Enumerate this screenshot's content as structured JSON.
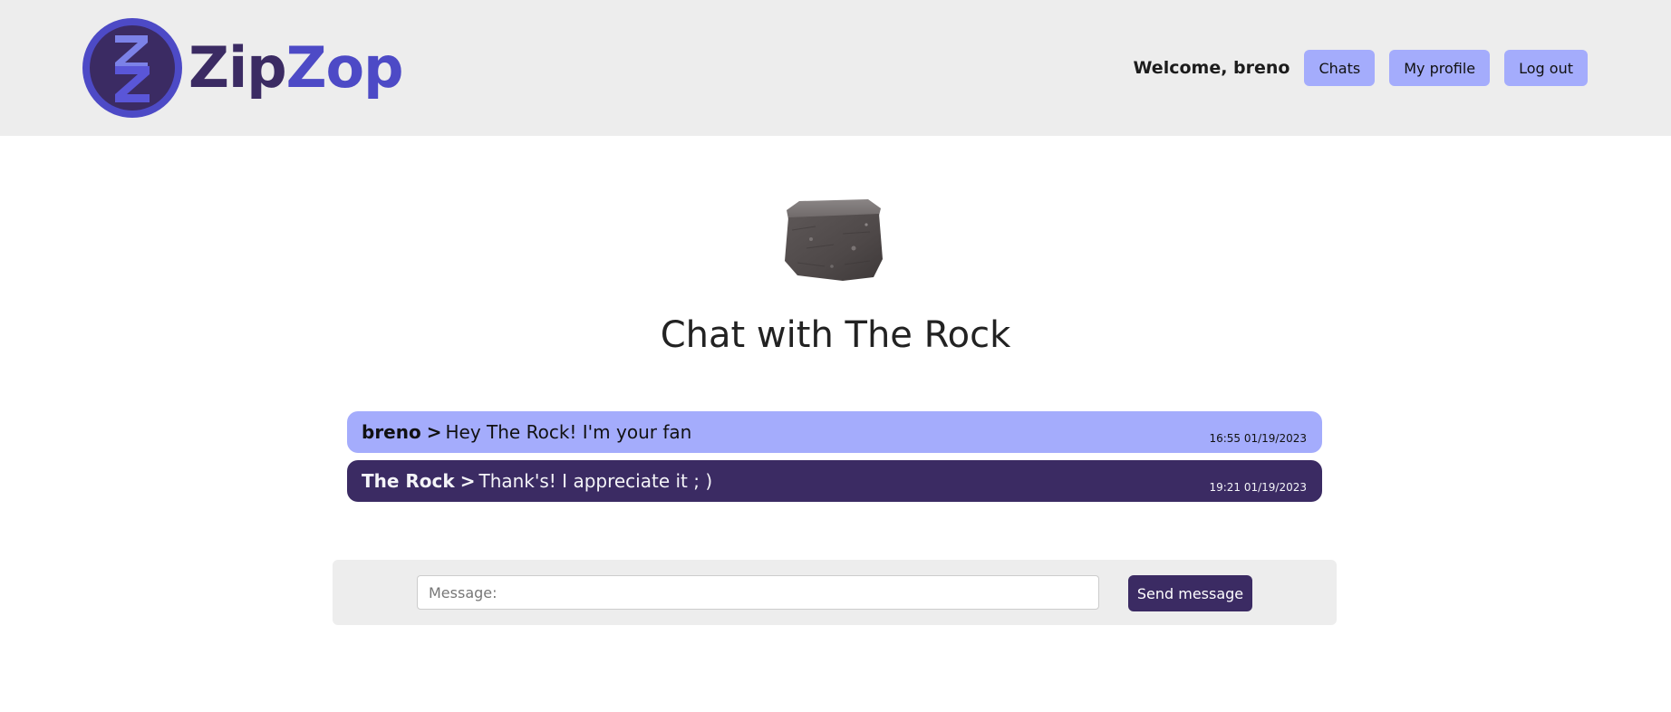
{
  "header": {
    "brand_part1": "Zip",
    "brand_part2": "Zop",
    "logo_icon": "zipzop-logo-icon",
    "welcome_text": "Welcome, breno",
    "nav": {
      "chats_label": "Chats",
      "profile_label": "My profile",
      "logout_label": "Log out"
    }
  },
  "chat": {
    "avatar_icon": "rock-avatar-image",
    "title": "Chat with The Rock",
    "messages": [
      {
        "author": "breno",
        "separator": ">",
        "text": "Hey The Rock! I'm your fan",
        "time": "16:55 01/19/2023"
      },
      {
        "author": "The Rock",
        "separator": ">",
        "text": "Thank's! I appreciate it ; )",
        "time": "19:21 01/19/2023"
      }
    ]
  },
  "composer": {
    "placeholder": "Message:",
    "value": "",
    "send_label": "Send message"
  },
  "colors": {
    "navbar_bg": "#ededed",
    "accent_light": "#a4acfc",
    "accent_dark": "#3b2b63",
    "brand_blue": "#4d4ac6"
  }
}
